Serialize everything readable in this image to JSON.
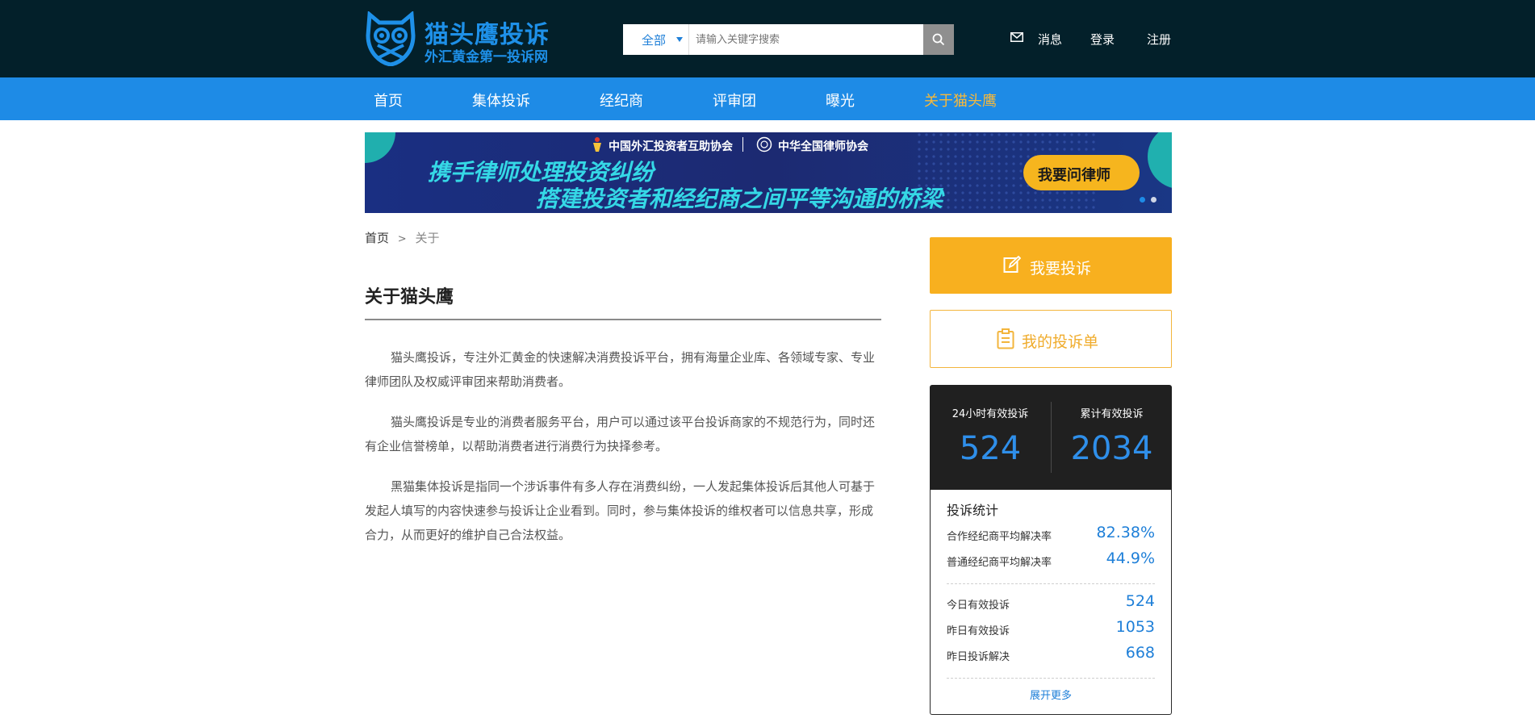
{
  "header": {
    "logo_title": "猫头鹰投诉",
    "logo_subtitle": "外汇黄金第一投诉网",
    "search": {
      "category": "全部",
      "placeholder": "请输入关键字搜索"
    },
    "links": {
      "messages": "消息",
      "login": "登录",
      "register": "注册"
    }
  },
  "nav": {
    "items": [
      "首页",
      "集体投诉",
      "经纪商",
      "评审团",
      "曝光",
      "关于猫头鹰"
    ],
    "active_index": 5,
    "active_color": "#f7b93b"
  },
  "banner": {
    "org1": "中国外汇投资者互助协会",
    "org2": "中华全国律师协会",
    "line1": "携手律师处理投资纠纷",
    "line2": "搭建投资者和经纪商之间平等沟通的桥梁",
    "cta": "我要问律师"
  },
  "breadcrumb": {
    "home": "首页",
    "sep": ">",
    "current": "关于"
  },
  "article": {
    "title": "关于猫头鹰",
    "paragraphs": [
      "猫头鹰投诉，专注外汇黄金的快速解决消费投诉平台，拥有海量企业库、各领域专家、专业律师团队及权威评审团来帮助消费者。",
      "猫头鹰投诉是专业的消费者服务平台，用户可以通过该平台投诉商家的不规范行为，同时还有企业信誉榜单，以帮助消费者进行消费行为抉择参考。",
      "黑猫集体投诉是指同一个涉诉事件有多人存在消费纠纷，一人发起集体投诉后其他人可基于发起人填写的内容快速参与投诉让企业看到。同时，参与集体投诉的维权者可以信息共享，形成合力，从而更好的维护自己合法权益。"
    ]
  },
  "sidebar": {
    "complain_label": "我要投诉",
    "my_list_label": "我的投诉单",
    "stats_24h_label": "24小时有效投诉",
    "stats_24h_value": "524",
    "stats_total_label": "累计有效投诉",
    "stats_total_value": "2034",
    "stats_title": "投诉统计",
    "rows_top": [
      {
        "label": "合作经纪商平均解决率",
        "value": "82.38%"
      },
      {
        "label": "普通经纪商平均解决率",
        "value": "44.9%"
      }
    ],
    "rows_bottom": [
      {
        "label": "今日有效投诉",
        "value": "524"
      },
      {
        "label": "昨日有效投诉",
        "value": "1053"
      },
      {
        "label": "昨日投诉解决",
        "value": "668"
      }
    ],
    "expand": "展开更多"
  },
  "colors": {
    "brand_blue": "#1e8be6",
    "accent_orange": "#f8b01f",
    "header_bg": "#03202a"
  }
}
